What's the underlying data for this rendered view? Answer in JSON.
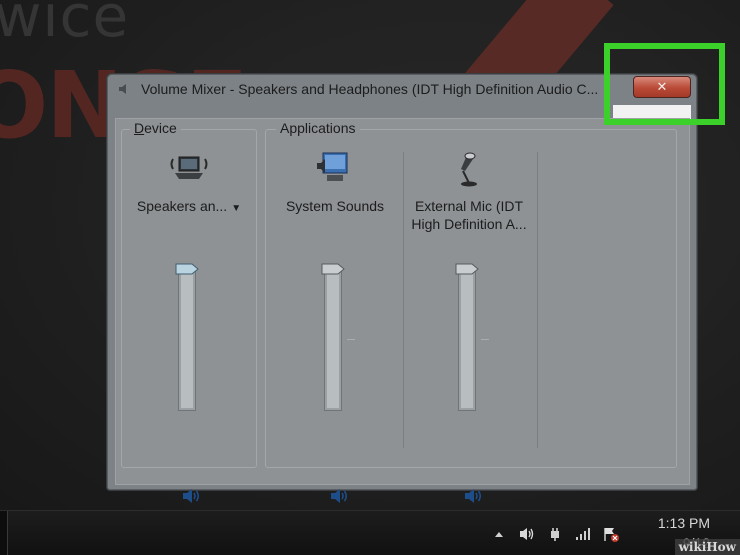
{
  "wallpaper": {
    "text_top": "wice",
    "text_big": "ONSE"
  },
  "window": {
    "title": "Volume Mixer - Speakers and Headphones (IDT High Definition Audio C...",
    "close_icon": "close-icon"
  },
  "groups": {
    "device_label_accel": "D",
    "device_label_rest": "evice",
    "applications_label": "Applications"
  },
  "channels": [
    {
      "label": "Speakers an...",
      "has_dropdown": true,
      "icon": "speaker-laptop-icon",
      "volume": 1.0
    },
    {
      "label": "System Sounds",
      "icon": "system-sounds-icon",
      "volume": 1.0
    },
    {
      "label": "External Mic (IDT High Definition A...",
      "icon": "microphone-icon",
      "volume": 1.0
    }
  ],
  "taskbar": {
    "clock_time": "1:13 PM",
    "clock_date": "9/12",
    "watermark": "wikiHow"
  },
  "colors": {
    "highlight": "#3bd12a",
    "close_button": "#b94a37"
  }
}
